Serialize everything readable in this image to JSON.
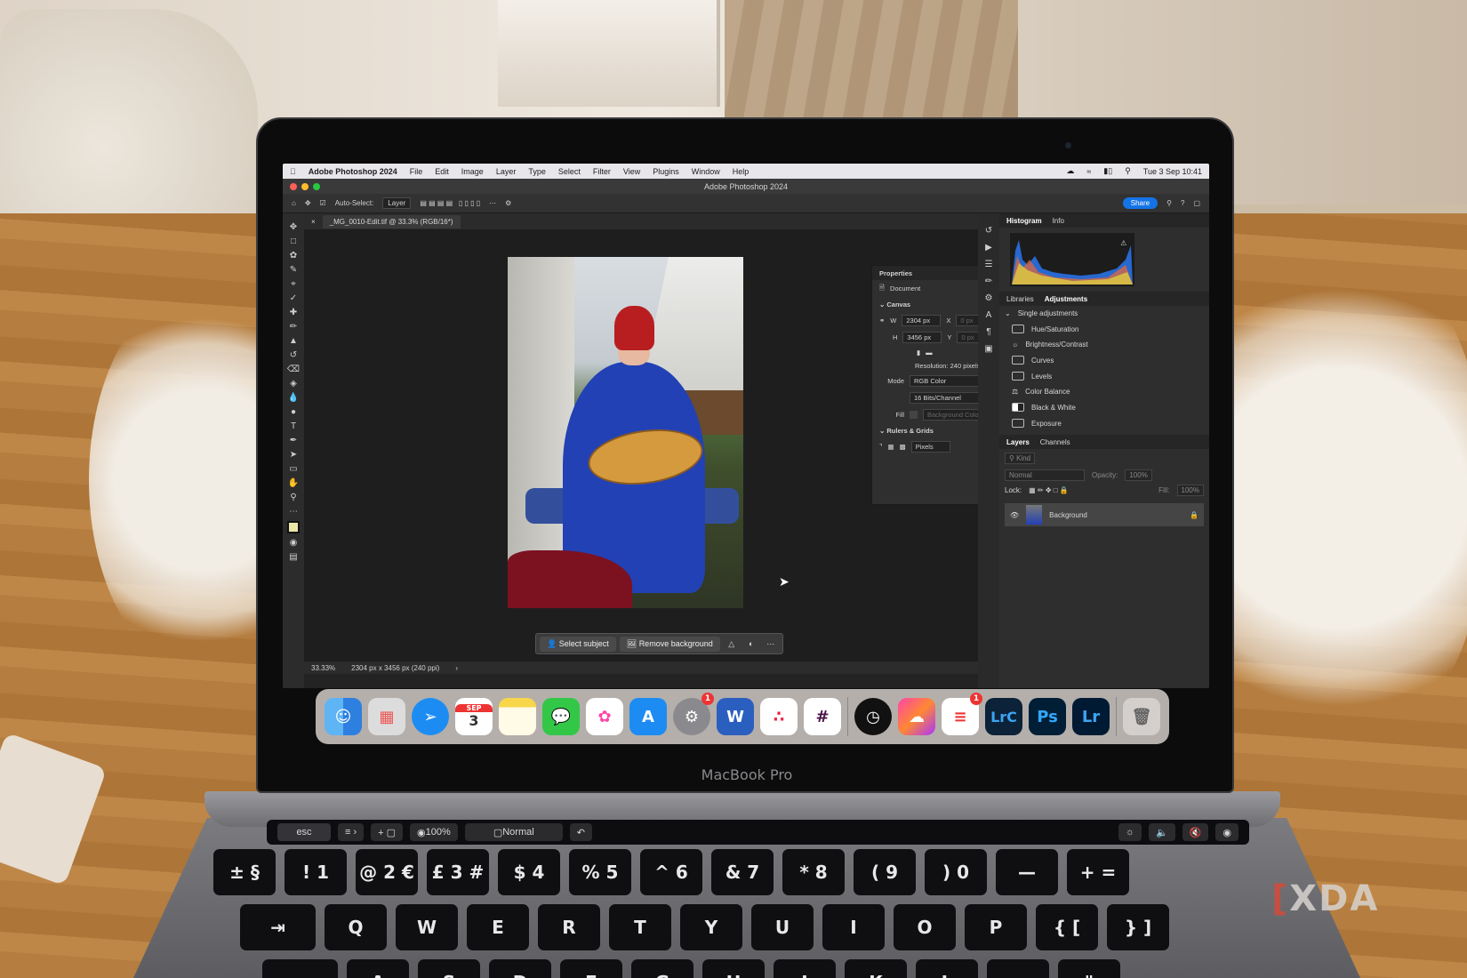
{
  "watermark": {
    "text": "XDA",
    "bracket": "["
  },
  "laptop": {
    "brand": "MacBook Pro"
  },
  "menubar": {
    "app_name": "Adobe Photoshop 2024",
    "items": [
      "File",
      "Edit",
      "Image",
      "Layer",
      "Type",
      "Select",
      "Filter",
      "View",
      "Plugins",
      "Window",
      "Help"
    ],
    "clock": "Tue 3 Sep  10:41"
  },
  "window": {
    "title": "Adobe Photoshop 2024"
  },
  "options_bar": {
    "auto_select_label": "Auto-Select:",
    "auto_select_value": "Layer",
    "share_label": "Share"
  },
  "document": {
    "tab_title": "_MG_0010-Edit.tif @ 33.3% (RGB/16*)",
    "zoom": "33.33%",
    "info": "2304 px x 3456 px (240 ppi)"
  },
  "context_bar": {
    "select_subject": "Select subject",
    "remove_background": "Remove background"
  },
  "properties": {
    "title": "Properties",
    "doc_label": "Document",
    "canvas_section": "Canvas",
    "w_label": "W",
    "w_value": "2304 px",
    "h_label": "H",
    "h_value": "3456 px",
    "x_label": "X",
    "x_value": "0 px",
    "y_label": "Y",
    "y_value": "0 px",
    "resolution": "Resolution: 240 pixels/inch",
    "mode_label": "Mode",
    "mode_value": "RGB Color",
    "depth_value": "16 Bits/Channel",
    "fill_label": "Fill",
    "fill_value": "Background Color",
    "rulers_section": "Rulers & Grids",
    "units_value": "Pixels"
  },
  "right_panel": {
    "histogram_tab": "Histogram",
    "info_tab": "Info",
    "libraries_tab": "Libraries",
    "adjustments_tab": "Adjustments",
    "single_adjustments": "Single adjustments",
    "adjustments": [
      "Hue/Saturation",
      "Brightness/Contrast",
      "Curves",
      "Levels",
      "Color Balance",
      "Black & White",
      "Exposure"
    ],
    "layers_tab": "Layers",
    "channels_tab": "Channels",
    "kind_label": "Kind",
    "blend_mode": "Normal",
    "opacity_label": "Opacity:",
    "opacity_value": "100%",
    "lock_label": "Lock:",
    "fill_label": "Fill:",
    "fill_value": "100%",
    "layer_name": "Background"
  },
  "dock": {
    "calendar_month": "SEP",
    "calendar_day": "3",
    "badges": {
      "settings": "1",
      "reminders": "1"
    },
    "apps": {
      "lrc": "LrC",
      "ps": "Ps",
      "lr": "Lr",
      "word": "W"
    }
  },
  "touch_bar": {
    "esc": "esc",
    "zoom": "100%",
    "mode": "Normal"
  },
  "keyboard": {
    "number_row": [
      "± §",
      "! 1",
      "@ 2 €",
      "£ 3 #",
      "$ 4",
      "% 5",
      "^ 6",
      "& 7",
      "* 8",
      "( 9",
      ") 0",
      "—",
      "+ ="
    ],
    "letter_row": [
      "Q",
      "W",
      "E",
      "R",
      "T",
      "Y",
      "U",
      "I",
      "O",
      "P",
      "{ [",
      "} ]"
    ],
    "home_row": [
      "A",
      "S",
      "D",
      "F",
      "G",
      "H",
      "J",
      "K",
      "L",
      ":",
      "\""
    ]
  },
  "colors": {
    "accent": "#1473e6",
    "dress": "#2241b5",
    "hat": "#b81e20",
    "ps_blue": "#31a8ff",
    "lr_blue": "#3ca5f2"
  }
}
